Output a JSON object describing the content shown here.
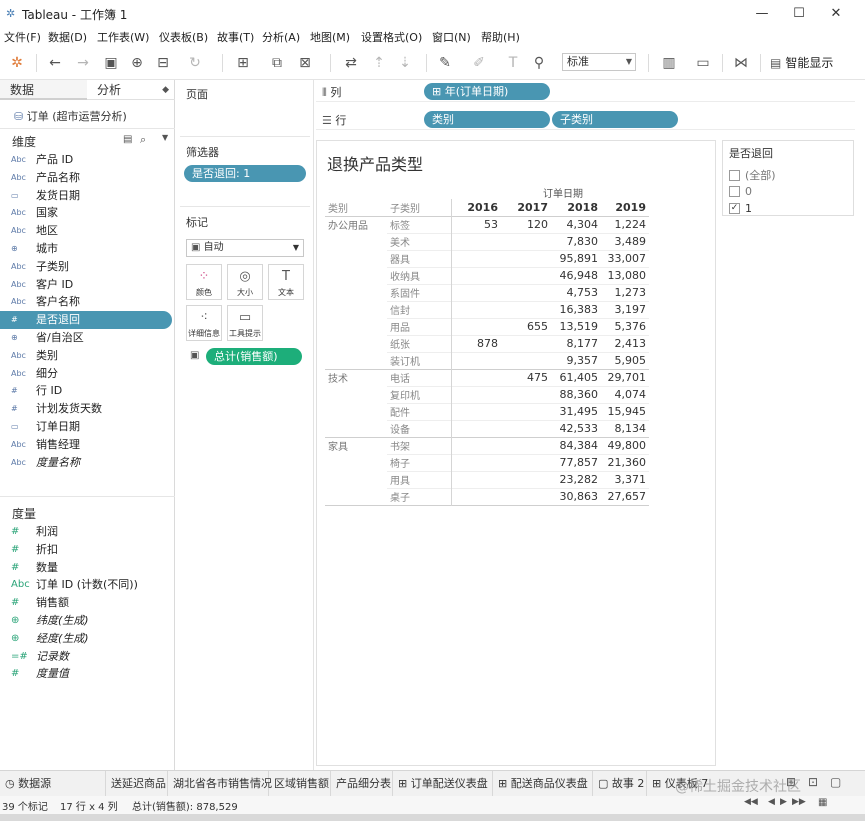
{
  "window": {
    "title": "Tableau - 工作簿 1"
  },
  "menu": [
    "文件(F)",
    "数据(D)",
    "工作表(W)",
    "仪表板(B)",
    "故事(T)",
    "分析(A)",
    "地图(M)",
    "设置格式(O)",
    "窗口(N)",
    "帮助(H)"
  ],
  "toolbar": {
    "fit_select": "标准",
    "show_me": "智能显示"
  },
  "left_pane": {
    "tabs": [
      "数据",
      "分析"
    ],
    "datasource": "订单 (超市运营分析)",
    "dimensions_header": "维度",
    "dimensions": [
      {
        "icon": "Abc",
        "label": "产品 ID"
      },
      {
        "icon": "Abc",
        "label": "产品名称"
      },
      {
        "icon": "calendar",
        "label": "发货日期"
      },
      {
        "icon": "Abc",
        "label": "国家"
      },
      {
        "icon": "Abc",
        "label": "地区"
      },
      {
        "icon": "globe",
        "label": "城市"
      },
      {
        "icon": "Abc",
        "label": "子类别"
      },
      {
        "icon": "Abc",
        "label": "客户 ID"
      },
      {
        "icon": "Abc",
        "label": "客户名称"
      },
      {
        "icon": "#",
        "label": "是否退回"
      },
      {
        "icon": "globe",
        "label": "省/自治区"
      },
      {
        "icon": "Abc",
        "label": "类别"
      },
      {
        "icon": "Abc",
        "label": "细分"
      },
      {
        "icon": "#",
        "label": "行 ID"
      },
      {
        "icon": "#",
        "label": "计划发货天数"
      },
      {
        "icon": "calendar",
        "label": "订单日期"
      },
      {
        "icon": "Abc",
        "label": "销售经理"
      },
      {
        "icon": "Abc",
        "label": "度量名称"
      }
    ],
    "measures_header": "度量",
    "measures": [
      {
        "icon": "#",
        "label": "利润"
      },
      {
        "icon": "#",
        "label": "折扣"
      },
      {
        "icon": "#",
        "label": "数量"
      },
      {
        "icon": "Abc",
        "label": "订单 ID (计数(不同))"
      },
      {
        "icon": "#",
        "label": "销售额"
      },
      {
        "icon": "globe",
        "label": "纬度(生成)"
      },
      {
        "icon": "globe",
        "label": "经度(生成)"
      },
      {
        "icon": "=#",
        "label": "记录数"
      },
      {
        "icon": "#",
        "label": "度量值"
      }
    ]
  },
  "shelves": {
    "pages": "页面",
    "filters": "筛选器",
    "filter_pill": "是否退回: 1",
    "marks": "标记",
    "mark_type": "自动",
    "mark_buttons": [
      "颜色",
      "大小",
      "文本",
      "详细信息",
      "工具提示"
    ],
    "mark_pill": "总计(销售额)",
    "columns_label": "列",
    "columns_pill": "年(订单日期)",
    "rows_label": "行",
    "rows_pills": [
      "类别",
      "子类别"
    ]
  },
  "sheet": {
    "title": "退换产品类型",
    "column_group": "订单日期",
    "headers": [
      "类别",
      "子类别",
      "2016",
      "2017",
      "2018",
      "2019"
    ],
    "groups": [
      {
        "category": "办公用品",
        "rows": [
          {
            "sub": "标签",
            "v": [
              "53",
              "120",
              "4,304",
              "1,224"
            ]
          },
          {
            "sub": "美术",
            "v": [
              "",
              "",
              "7,830",
              "3,489"
            ]
          },
          {
            "sub": "器具",
            "v": [
              "",
              "",
              "95,891",
              "33,007"
            ]
          },
          {
            "sub": "收纳具",
            "v": [
              "",
              "",
              "46,948",
              "13,080"
            ]
          },
          {
            "sub": "系固件",
            "v": [
              "",
              "",
              "4,753",
              "1,273"
            ]
          },
          {
            "sub": "信封",
            "v": [
              "",
              "",
              "16,383",
              "3,197"
            ]
          },
          {
            "sub": "用品",
            "v": [
              "",
              "655",
              "13,519",
              "5,376"
            ]
          },
          {
            "sub": "纸张",
            "v": [
              "878",
              "",
              "8,177",
              "2,413"
            ]
          },
          {
            "sub": "装订机",
            "v": [
              "",
              "",
              "9,357",
              "5,905"
            ]
          }
        ]
      },
      {
        "category": "技术",
        "rows": [
          {
            "sub": "电话",
            "v": [
              "",
              "475",
              "61,405",
              "29,701"
            ]
          },
          {
            "sub": "复印机",
            "v": [
              "",
              "",
              "88,360",
              "4,074"
            ]
          },
          {
            "sub": "配件",
            "v": [
              "",
              "",
              "31,495",
              "15,945"
            ]
          },
          {
            "sub": "设备",
            "v": [
              "",
              "",
              "42,533",
              "8,134"
            ]
          }
        ]
      },
      {
        "category": "家具",
        "rows": [
          {
            "sub": "书架",
            "v": [
              "",
              "",
              "84,384",
              "49,800"
            ]
          },
          {
            "sub": "椅子",
            "v": [
              "",
              "",
              "77,857",
              "21,360"
            ]
          },
          {
            "sub": "用具",
            "v": [
              "",
              "",
              "23,282",
              "3,371"
            ]
          },
          {
            "sub": "桌子",
            "v": [
              "",
              "",
              "30,863",
              "27,657"
            ]
          }
        ]
      }
    ]
  },
  "filter_card": {
    "title": "是否退回",
    "options": [
      {
        "label": "(全部)",
        "checked": false
      },
      {
        "label": "0",
        "checked": false
      },
      {
        "label": "1",
        "checked": true
      }
    ]
  },
  "sheet_tabs": [
    "数据源",
    "送延迟商品",
    "湖北省各市销售情况",
    "区域销售额",
    "产品细分表",
    "订单配送仪表盘",
    "配送商品仪表盘",
    "故事 2",
    "仪表板 7"
  ],
  "status": {
    "marks": "39 个标记",
    "dims": "17 行 x 4 列",
    "sum": "总计(销售额): 878,529"
  },
  "watermark": "@稀土掘金技术社区"
}
